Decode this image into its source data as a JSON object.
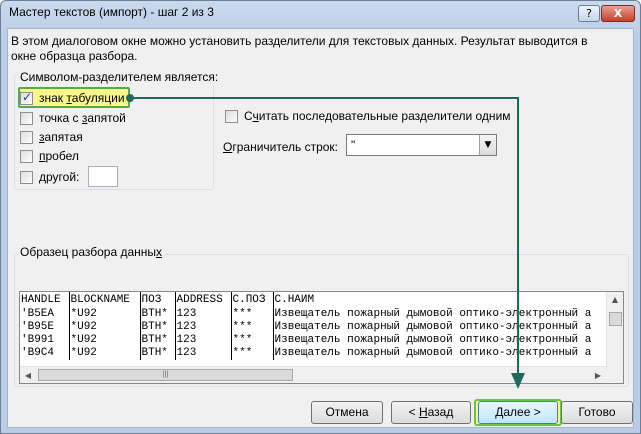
{
  "window": {
    "title": "Мастер текстов (импорт) - шаг 2 из 3",
    "help_label": "?",
    "close_label": "X"
  },
  "description": "В этом диалоговом окне можно установить разделители для текстовых данных. Результат выводится в окне образца разбора.",
  "delimiters": {
    "legend": "Символом-разделителем является:",
    "tab": {
      "label": "знак табуляции",
      "checked": true
    },
    "semicolon": {
      "label": "точка с запятой",
      "checked": false
    },
    "comma": {
      "label": "запятая",
      "checked": false
    },
    "space": {
      "label": "пробел",
      "checked": false
    },
    "other": {
      "label": "другой:",
      "checked": false,
      "value": ""
    }
  },
  "consecutive": {
    "label": "Считать последовательные разделители одним",
    "checked": false
  },
  "text_qualifier": {
    "label": "Ограничитель строк:",
    "value": "\""
  },
  "preview": {
    "legend": "Образец разбора данных",
    "headers": [
      "HANDLE",
      "BLOCKNAME",
      "ПОЗ",
      "ADDRESS",
      "С.ПОЗ",
      "С.НАИМ"
    ],
    "rows": [
      [
        "'B5EA",
        "*U92",
        "ВТН*",
        "123",
        "***",
        "Извещатель пожарный дымовой оптико-электронный а"
      ],
      [
        "'B95E",
        "*U92",
        "ВТН*",
        "123",
        "***",
        "Извещатель пожарный дымовой оптико-электронный а"
      ],
      [
        "'B991",
        "*U92",
        "ВТН*",
        "123",
        "***",
        "Извещатель пожарный дымовой оптико-электронный а"
      ],
      [
        "'B9C4",
        "*U92",
        "ВТН*",
        "123",
        "***",
        "Извещатель пожарный дымовой оптико-электронный а"
      ]
    ]
  },
  "buttons": {
    "cancel": "Отмена",
    "back": "< Назад",
    "next": "Далее >",
    "finish": "Готово"
  },
  "colors": {
    "highlight": "#f7f78a",
    "annotation_arrow": "#1e6b5c",
    "annotation_border": "#6cc24a"
  }
}
